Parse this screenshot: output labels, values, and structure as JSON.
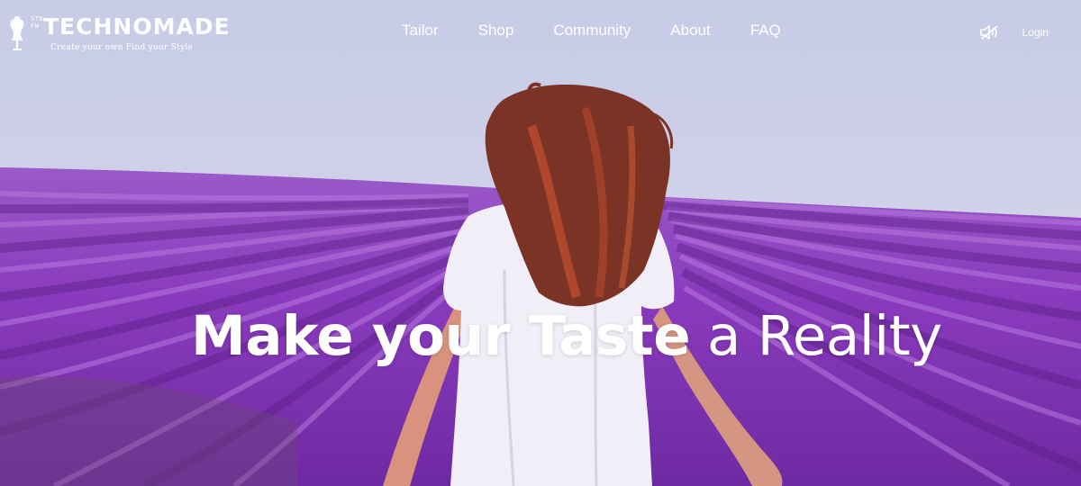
{
  "brand": {
    "small_mark": "STD\nFW",
    "name": "TECHNOMADE",
    "tagline": "Create your own  Find your Style"
  },
  "nav": {
    "items": [
      {
        "label": "Tailor"
      },
      {
        "label": "Shop"
      },
      {
        "label": "Community"
      },
      {
        "label": "About"
      },
      {
        "label": "FAQ"
      }
    ],
    "login_label": "Login",
    "mute_icon": "speaker-muted-icon"
  },
  "hero": {
    "headline_bold": "Make your Taste",
    "headline_thin": "a Reality",
    "scene": "woman-in-white-dress-running-through-lavender-field",
    "colors": {
      "sky": "#d6d7ea",
      "lavender": "#8a3fbf",
      "dress": "#f1eef7",
      "hair": "#8a3a2a"
    }
  }
}
